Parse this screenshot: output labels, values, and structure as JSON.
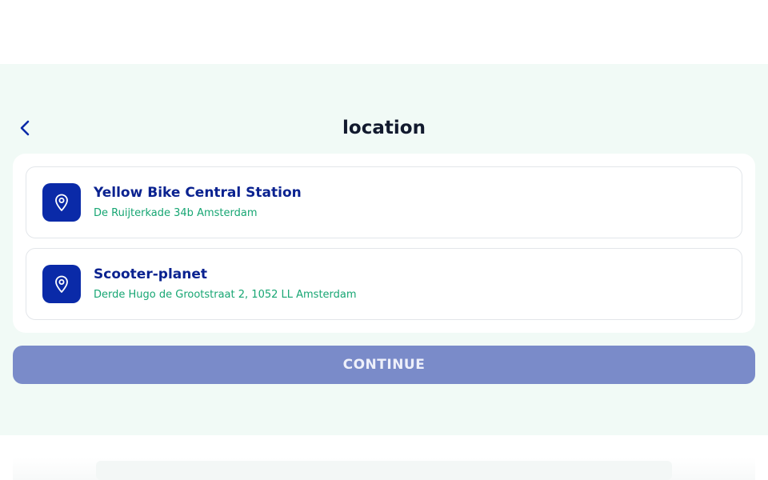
{
  "header": {
    "title": "location",
    "back_icon": "chevron-left-icon"
  },
  "locations": [
    {
      "name": "Yellow Bike Central Station",
      "address": "De Ruijterkade 34b Amsterdam",
      "icon": "map-pin-icon"
    },
    {
      "name": "Scooter-planet",
      "address": "Derde Hugo de Grootstraat 2, 1052 LL Amsterdam",
      "icon": "map-pin-icon"
    }
  ],
  "actions": {
    "continue_label": "CONTINUE"
  },
  "colors": {
    "accent": "#0a2aa8",
    "address_green": "#17a673",
    "button_disabled": "#7a8bc9",
    "panel_bg": "#f1faf6"
  }
}
